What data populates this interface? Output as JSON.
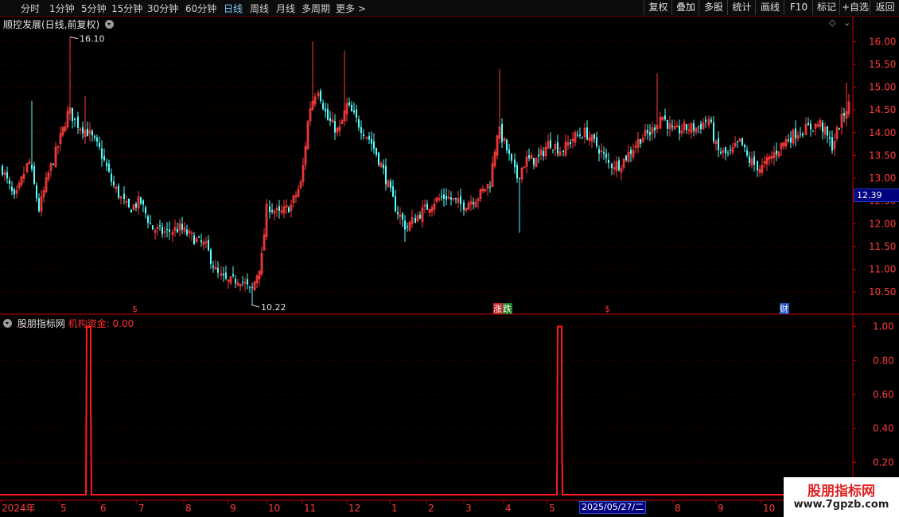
{
  "toolbar": {
    "periods": [
      "分时",
      "1分钟",
      "5分钟",
      "15分钟",
      "30分钟",
      "60分钟",
      "日线",
      "周线",
      "月线",
      "多周期",
      "更多 >"
    ],
    "active_period": "日线",
    "buttons": [
      "复权",
      "叠加",
      "多股",
      "统计",
      "画线",
      "F10",
      "标记",
      "+自选",
      "返回"
    ]
  },
  "main_chart": {
    "title": "顺控发展(日线,前复权)",
    "high_label": "16.10",
    "low_label": "10.22",
    "current_price": "12.39",
    "price_axis": [
      "16.00",
      "15.50",
      "15.00",
      "14.50",
      "14.00",
      "13.50",
      "13.00",
      "12.50",
      "12.00",
      "11.50",
      "11.00",
      "10.50"
    ],
    "events": [
      {
        "text": "$",
        "color": "#ff3030",
        "bg": ""
      },
      {
        "text": "涨",
        "color": "#ffffff",
        "bg": "#c02020"
      },
      {
        "text": "跌",
        "color": "#ffffff",
        "bg": "#208020"
      },
      {
        "text": "$",
        "color": "#ff3030",
        "bg": ""
      },
      {
        "text": "财",
        "color": "#ffffff",
        "bg": "#2050c0"
      }
    ]
  },
  "indicator": {
    "title": "股朋指标网",
    "label": "机构资金: 0.00",
    "axis": [
      "1.00",
      "0.80",
      "0.60",
      "0.40",
      "0.20"
    ]
  },
  "time_axis": [
    "2024年",
    "5",
    "6",
    "7",
    "8",
    "9",
    "10",
    "11",
    "12",
    "1",
    "2",
    "3",
    "4",
    "5",
    "2025/05/27/二",
    "8",
    "9",
    "10"
  ],
  "watermark": {
    "title": "股朋指标网",
    "url": "www.7gpzb.com"
  },
  "icons": [
    "diamond-icon",
    "chevron-down-icon"
  ],
  "colors": {
    "up": "#ff3c3c",
    "down": "#54ffff",
    "grid": "#5a0000",
    "indicator": "#ff1a1a",
    "axis": "#c80000"
  },
  "chart_data": {
    "type": "candlestick",
    "price_ylim": [
      10.1,
      16.25
    ],
    "indicator_ylim": [
      0,
      1.05
    ],
    "indicator_spikes": [
      {
        "segment": "5",
        "value": 1.0
      },
      {
        "segment": "5",
        "value": 1.0
      }
    ]
  }
}
